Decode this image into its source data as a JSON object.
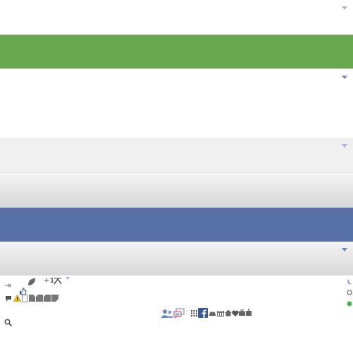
{
  "colors": {
    "white": "#ffffff",
    "green": "#69a84f",
    "light_gray": "#f0f0f0",
    "gray_gradient_top": "#f2f2f2",
    "gray_gradient_bottom": "#d9d9d9",
    "facebook_blue": "#5872a8",
    "dropdown_arrow": "#6d86c9",
    "online_green": "#4caf50"
  },
  "bands": [
    {
      "name": "white-dropdown-band",
      "style": "white",
      "dropdown": true
    },
    {
      "name": "green-band",
      "style": "green",
      "dropdown": false
    },
    {
      "name": "white-dropdown-band-large",
      "style": "white",
      "dropdown": true
    },
    {
      "name": "light-gray-dropdown-band",
      "style": "light_gray",
      "dropdown": true
    },
    {
      "name": "gray-gradient-band",
      "style": "gray_gradient",
      "dropdown": false
    },
    {
      "name": "facebook-blue-band",
      "style": "facebook_blue",
      "dropdown": false
    },
    {
      "name": "gray-gradient-dropdown-band",
      "style": "gray_gradient",
      "dropdown": true
    }
  ],
  "icons": {
    "row1": [
      "login-arrow-icon",
      "leaf-icon",
      "plus-one-icon",
      "chevron-up-icon",
      "dropdown-arrow-icon"
    ],
    "row2": [
      "like-thumb-icon"
    ],
    "row3": [
      "comment-icon",
      "warning-icon",
      "phone-icon",
      "bookmark-icon",
      "tag-icon",
      "tag-icon",
      "flag-icon"
    ],
    "sprite_strip": [
      "friends-icon",
      "messages-icon",
      "grid-icon",
      "facebook-icon",
      "car-icon",
      "calendar-icon",
      "home-icon",
      "heart-icon",
      "briefcase-icon",
      "gift-icon"
    ],
    "status_indicators": [
      "moon-icon",
      "offline-circle-icon",
      "online-dot-icon"
    ],
    "search": "search-icon"
  }
}
